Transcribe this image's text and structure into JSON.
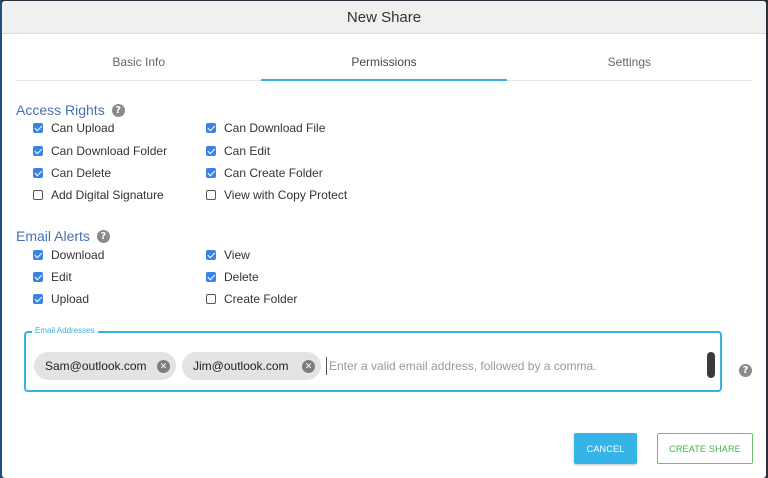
{
  "dialog": {
    "title": "New Share"
  },
  "tabs": [
    {
      "label": "Basic Info",
      "active": false
    },
    {
      "label": "Permissions",
      "active": true
    },
    {
      "label": "Settings",
      "active": false
    }
  ],
  "access_rights": {
    "heading": "Access Rights",
    "help_icon": "?",
    "items": [
      {
        "label": "Can Upload",
        "checked": true
      },
      {
        "label": "Can Download File",
        "checked": true
      },
      {
        "label": "Can Download Folder",
        "checked": true
      },
      {
        "label": "Can Edit",
        "checked": true
      },
      {
        "label": "Can Delete",
        "checked": true
      },
      {
        "label": "Can Create Folder",
        "checked": true
      },
      {
        "label": "Add Digital Signature",
        "checked": false
      },
      {
        "label": "View with Copy Protect",
        "checked": false
      }
    ]
  },
  "email_alerts": {
    "heading": "Email Alerts",
    "help_icon": "?",
    "items": [
      {
        "label": "Download",
        "checked": true
      },
      {
        "label": "View",
        "checked": true
      },
      {
        "label": "Edit",
        "checked": true
      },
      {
        "label": "Delete",
        "checked": true
      },
      {
        "label": "Upload",
        "checked": true
      },
      {
        "label": "Create Folder",
        "checked": false
      }
    ]
  },
  "email_addresses": {
    "legend": "Email Addresses",
    "chips": [
      "Sam@outlook.com",
      "Jim@outlook.com"
    ],
    "remove_icon": "✕",
    "placeholder": "Enter a valid email address, followed by a comma.",
    "help_icon": "?"
  },
  "buttons": {
    "cancel": "CANCEL",
    "create": "CREATE SHARE"
  },
  "colors": {
    "accent": "#3ab0e0",
    "checkbox": "#3b82e6",
    "heading": "#4a6fb0",
    "create": "#42b349"
  }
}
